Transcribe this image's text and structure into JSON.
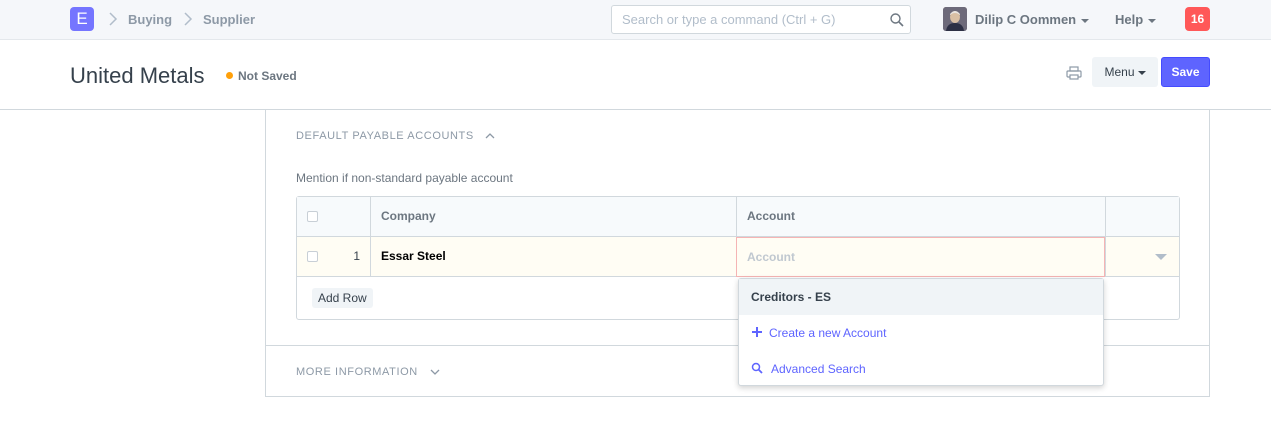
{
  "navbar": {
    "logo_letter": "E",
    "breadcrumbs": [
      "Buying",
      "Supplier"
    ],
    "search_placeholder": "Search or type a command (Ctrl + G)",
    "user_name": "Dilip C Oommen",
    "help_label": "Help",
    "notification_count": "16"
  },
  "page": {
    "title": "United Metals",
    "status": "Not Saved",
    "menu_label": "Menu",
    "save_label": "Save"
  },
  "sections": {
    "payable": {
      "title": "DEFAULT PAYABLE ACCOUNTS",
      "description": "Mention if non-standard payable account"
    },
    "more": {
      "title": "MORE INFORMATION"
    }
  },
  "grid": {
    "columns": [
      "Company",
      "Account"
    ],
    "rows": [
      {
        "idx": "1",
        "company": "Essar Steel",
        "account": ""
      }
    ],
    "account_placeholder": "Account",
    "add_row_label": "Add Row"
  },
  "dropdown": {
    "items": [
      {
        "label": "Creditors - ES",
        "icon": ""
      },
      {
        "label": "Create a new Account",
        "icon": "plus-icon"
      },
      {
        "label": "Advanced Search",
        "icon": "search-icon"
      }
    ]
  },
  "colors": {
    "brand": "#7575ff",
    "primary_button": "#5e64ff",
    "notification": "#ff5858",
    "status_dot": "#ffa00a"
  }
}
